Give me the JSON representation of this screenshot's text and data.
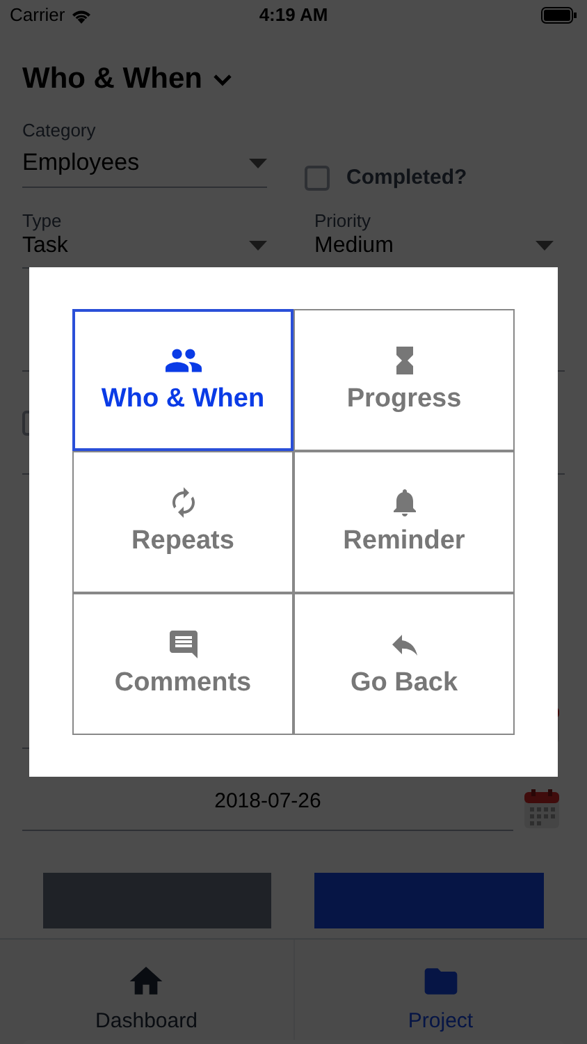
{
  "status_bar": {
    "carrier": "Carrier",
    "time": "4:19 AM"
  },
  "header": {
    "title": "Who & When"
  },
  "form": {
    "category": {
      "label": "Category",
      "value": "Employees"
    },
    "completed": {
      "label": "Completed?",
      "checked": false
    },
    "type": {
      "label": "Type",
      "value": "Task"
    },
    "priority": {
      "label": "Priority",
      "value": "Medium"
    },
    "partial_checkbox": {
      "checked": false
    },
    "date": "2018-07-26"
  },
  "menu": {
    "items": [
      {
        "label": "Who & When",
        "kind": "people",
        "selected": true
      },
      {
        "label": "Progress",
        "kind": "hourglass",
        "selected": false
      },
      {
        "label": "Repeats",
        "kind": "sync",
        "selected": false
      },
      {
        "label": "Reminder",
        "kind": "bell",
        "selected": false
      },
      {
        "label": "Comments",
        "kind": "comment",
        "selected": false
      },
      {
        "label": "Go Back",
        "kind": "reply",
        "selected": false
      }
    ]
  },
  "tab_bar": {
    "tabs": [
      {
        "label": "Dashboard",
        "kind": "home",
        "selected": false
      },
      {
        "label": "Project",
        "kind": "folder",
        "selected": true
      }
    ]
  }
}
